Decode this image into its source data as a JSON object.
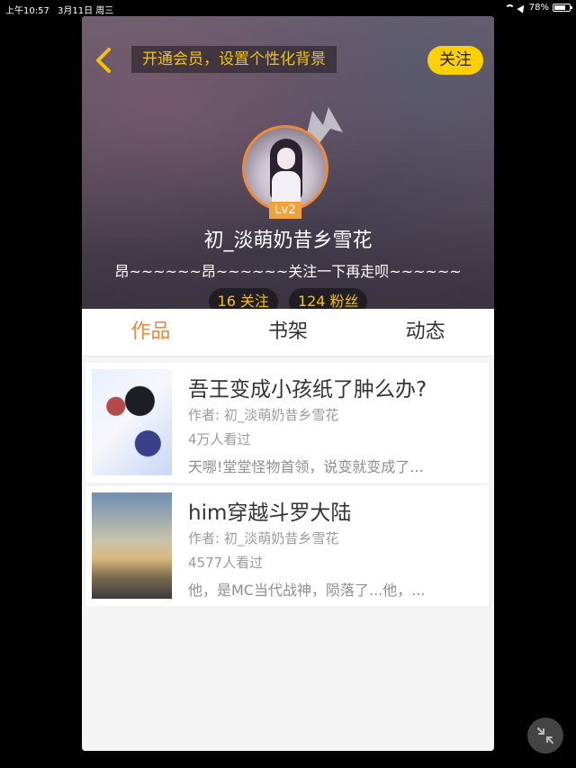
{
  "status_bar": {
    "time": "上午10:57",
    "date": "3月11日 周三",
    "battery": "78%",
    "battery_level": 0.78
  },
  "header": {
    "vip_banner": "开通会员，设置个性化背景",
    "follow_label": "关注",
    "level": "Lv2",
    "username": "初_淡萌奶昔乡雪花",
    "bio": "昂~~~~~~昂~~~~~~关注一下再走呗~~~~~~",
    "following": {
      "count": "16",
      "label": "关注"
    },
    "followers": {
      "count": "124",
      "label": "粉丝"
    }
  },
  "tabs": [
    {
      "label": "作品",
      "active": true
    },
    {
      "label": "书架",
      "active": false
    },
    {
      "label": "动态",
      "active": false
    }
  ],
  "books": [
    {
      "title": "吾王变成小孩纸了肿么办?",
      "author": "作者: 初_淡萌奶昔乡雪花",
      "views": "4万人看过",
      "desc": "天哪!堂堂怪物首领，说变就变成了..."
    },
    {
      "title": "him穿越斗罗大陆",
      "author": "作者: 初_淡萌奶昔乡雪花",
      "views": "4577人看过",
      "desc": "他，是MC当代战神，陨落了...他，..."
    }
  ],
  "colors": {
    "accent": "#f08a3a",
    "follow_bg": "#ffd000",
    "vip_text": "#f5c400"
  },
  "icons": {
    "back": "chevron-left-icon",
    "crown": "crown-icon",
    "collapse": "collapse-arrows-icon"
  }
}
